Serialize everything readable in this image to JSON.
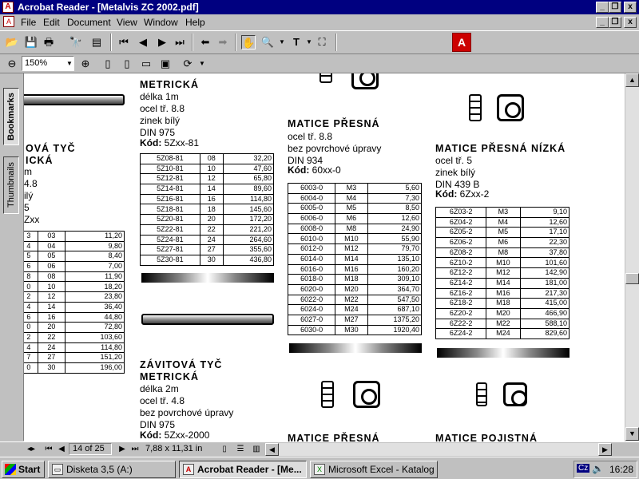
{
  "window": {
    "title": "Acrobat Reader - [Metalvis ZC 2002.pdf]",
    "minimize": "_",
    "restore": "❐",
    "close": "x"
  },
  "menu": [
    "File",
    "Edit",
    "Document",
    "View",
    "Window",
    "Help"
  ],
  "toolbar2": {
    "zoom": "150%"
  },
  "sidebar": {
    "bookmarks": "Bookmarks",
    "thumbnails": "Thumbnails"
  },
  "status": {
    "page": "14 of 25",
    "size": "7,88 x 11,31 in"
  },
  "taskbar": {
    "start": "Start",
    "tasks": [
      "Disketa 3,5 (A:)",
      "Acrobat Reader - [Me...",
      "Microsoft Excel - Katalog"
    ],
    "lang": "Cz",
    "clock": "16:28"
  },
  "doc": {
    "col0": {
      "heading": [
        "OVÁ TYČ",
        "ICKÁ"
      ],
      "lines": [
        "m",
        "4.8",
        "ilý",
        "5",
        "Zxx"
      ],
      "rows": [
        [
          "3",
          "03",
          "11,20"
        ],
        [
          "4",
          "04",
          "9,80"
        ],
        [
          "5",
          "05",
          "8,40"
        ],
        [
          "6",
          "06",
          "7,00"
        ],
        [
          "8",
          "08",
          "11,90"
        ],
        [
          "0",
          "10",
          "18,20"
        ],
        [
          "2",
          "12",
          "23,80"
        ],
        [
          "4",
          "14",
          "36,40"
        ],
        [
          "6",
          "16",
          "44,80"
        ],
        [
          "0",
          "20",
          "72,80"
        ],
        [
          "2",
          "22",
          "103,60"
        ],
        [
          "4",
          "24",
          "114,80"
        ],
        [
          "7",
          "27",
          "151,20"
        ],
        [
          "0",
          "30",
          "196,00"
        ]
      ]
    },
    "col1": {
      "heading_top": "METRICKÁ",
      "lines": [
        "délka 1m",
        "ocel tř. 8.8",
        "zinek bílý",
        "DIN 975"
      ],
      "kod_label": "Kód:",
      "kod": "5Zxx-81",
      "rows": [
        [
          "5Z08-81",
          "08",
          "32,20"
        ],
        [
          "5Z10-81",
          "10",
          "47,60"
        ],
        [
          "5Z12-81",
          "12",
          "65,80"
        ],
        [
          "5Z14-81",
          "14",
          "89,60"
        ],
        [
          "5Z16-81",
          "16",
          "114,80"
        ],
        [
          "5Z18-81",
          "18",
          "145,60"
        ],
        [
          "5Z20-81",
          "20",
          "172,20"
        ],
        [
          "5Z22-81",
          "22",
          "221,20"
        ],
        [
          "5Z24-81",
          "24",
          "264,60"
        ],
        [
          "5Z27-81",
          "27",
          "355,60"
        ],
        [
          "5Z30-81",
          "30",
          "436,80"
        ]
      ],
      "heading2": [
        "ZÁVITOVÁ TYČ",
        "METRICKÁ"
      ],
      "lines2": [
        "délka 2m",
        "ocel tř. 4.8",
        "bez povrchové úpravy",
        "DIN 975"
      ],
      "kod2": "5Zxx-2000"
    },
    "col2": {
      "heading": "MATICE PŘESNÁ",
      "lines": [
        "ocel tř. 8.8",
        "bez povrchové úpravy",
        "DIN 934"
      ],
      "kod_label": "Kód:",
      "kod": "60xx-0",
      "rows": [
        [
          "6003-0",
          "M3",
          "5,60"
        ],
        [
          "6004-0",
          "M4",
          "7,30"
        ],
        [
          "6005-0",
          "M5",
          "8,50"
        ],
        [
          "6006-0",
          "M6",
          "12,60"
        ],
        [
          "6008-0",
          "M8",
          "24,90"
        ],
        [
          "6010-0",
          "M10",
          "55,90"
        ],
        [
          "6012-0",
          "M12",
          "79,70"
        ],
        [
          "6014-0",
          "M14",
          "135,10"
        ],
        [
          "6016-0",
          "M16",
          "160,20"
        ],
        [
          "6018-0",
          "M18",
          "309,10"
        ],
        [
          "6020-0",
          "M20",
          "364,70"
        ],
        [
          "6022-0",
          "M22",
          "547,50"
        ],
        [
          "6024-0",
          "M24",
          "687,10"
        ],
        [
          "6027-0",
          "M27",
          "1375,20"
        ],
        [
          "6030-0",
          "M30",
          "1920,40"
        ]
      ],
      "heading_bottom": "MATICE PŘESNÁ"
    },
    "col3": {
      "heading": "MATICE PŘESNÁ NÍZKÁ",
      "lines": [
        "ocel tř. 5",
        "zinek bílý",
        "DIN 439 B"
      ],
      "kod_label": "Kód:",
      "kod": "6Zxx-2",
      "rows": [
        [
          "6Z03-2",
          "M3",
          "9,10"
        ],
        [
          "6Z04-2",
          "M4",
          "12,60"
        ],
        [
          "6Z05-2",
          "M5",
          "17,10"
        ],
        [
          "6Z06-2",
          "M6",
          "22,30"
        ],
        [
          "6Z08-2",
          "M8",
          "37,80"
        ],
        [
          "6Z10-2",
          "M10",
          "101,60"
        ],
        [
          "6Z12-2",
          "M12",
          "142,90"
        ],
        [
          "6Z14-2",
          "M14",
          "181,00"
        ],
        [
          "6Z16-2",
          "M16",
          "217,30"
        ],
        [
          "6Z18-2",
          "M18",
          "415,00"
        ],
        [
          "6Z20-2",
          "M20",
          "466,90"
        ],
        [
          "6Z22-2",
          "M22",
          "588,10"
        ],
        [
          "6Z24-2",
          "M24",
          "829,60"
        ]
      ],
      "heading_bottom": "MATICE POJISTNÁ"
    }
  }
}
